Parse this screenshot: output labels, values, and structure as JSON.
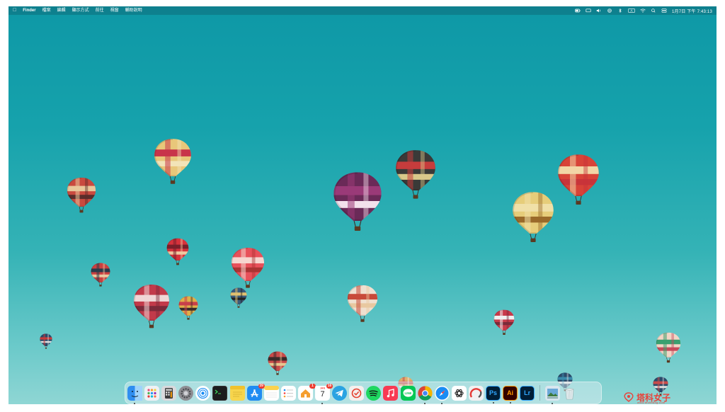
{
  "menubar": {
    "apple_icon": "apple-icon",
    "app_name": "Finder",
    "items": [
      "檔案",
      "編輯",
      "顯示方式",
      "前往",
      "視窗",
      "輔助說明"
    ],
    "status_icons": [
      "battery-icon",
      "display-icon",
      "volume-icon",
      "airdrop-icon",
      "bluetooth-icon",
      "input-source-icon",
      "wifi-icon",
      "search-icon",
      "control-center-icon"
    ],
    "input_source_label": "A",
    "clock": "1月7日 下午 7:43:13"
  },
  "dock": {
    "apps": [
      {
        "name": "Finder",
        "icon": "finder-icon",
        "color": "#2f8ef0",
        "running": true
      },
      {
        "name": "Launchpad",
        "icon": "launchpad-icon",
        "color": "#eef1f5",
        "running": false
      },
      {
        "name": "Calculator",
        "icon": "calculator-icon",
        "color": "#3a3a3c",
        "running": false
      },
      {
        "name": "System Settings",
        "icon": "gear-icon",
        "color": "#8e8e93",
        "running": false
      },
      {
        "name": "AirDrop",
        "icon": "airdrop-icon",
        "color": "#ffffff",
        "running": false
      },
      {
        "name": "Terminal",
        "icon": "terminal-icon",
        "color": "#1c1c1e",
        "running": false
      },
      {
        "name": "Stickies",
        "icon": "stickies-icon",
        "color": "#f7d54c",
        "running": false
      },
      {
        "name": "App Store",
        "icon": "app-store-icon",
        "color": "#1f8cf2",
        "running": false,
        "badge": "39"
      },
      {
        "name": "Notes",
        "icon": "notes-icon",
        "color": "#fbe27a",
        "running": false
      },
      {
        "name": "Reminders",
        "icon": "reminders-icon",
        "color": "#ffffff",
        "running": false
      },
      {
        "name": "Home",
        "icon": "home-icon",
        "color": "#ffffff",
        "running": false,
        "badge": "1"
      },
      {
        "name": "Calendar",
        "icon": "calendar-icon",
        "color": "#ffffff",
        "running": true,
        "badge": "16",
        "day": "7"
      },
      {
        "name": "Telegram",
        "icon": "telegram-icon",
        "color": "#2aa3e2",
        "running": false
      },
      {
        "name": "Todoist",
        "icon": "todoist-icon",
        "color": "#f4f0ee",
        "running": false
      },
      {
        "name": "Spotify",
        "icon": "spotify-icon",
        "color": "#1ed760",
        "running": false
      },
      {
        "name": "Music",
        "icon": "music-icon",
        "color": "#f83a53",
        "running": false
      },
      {
        "name": "LINE",
        "icon": "line-icon",
        "color": "#06c755",
        "running": false
      },
      {
        "name": "Chrome",
        "icon": "chrome-icon",
        "color": "#ffffff",
        "running": true
      },
      {
        "name": "Safari",
        "icon": "safari-icon",
        "color": "#1a8cf4",
        "running": true
      },
      {
        "name": "ChatGPT",
        "icon": "chatgpt-icon",
        "color": "#ffffff",
        "running": false
      },
      {
        "name": "Screen Recorder",
        "icon": "recorder-icon",
        "color": "#f1f1f1",
        "running": false
      },
      {
        "name": "Photoshop",
        "icon": "photoshop-icon",
        "color": "#001e36",
        "running": true,
        "label": "Ps",
        "label_color": "#31a8ff"
      },
      {
        "name": "Illustrator",
        "icon": "illustrator-icon",
        "color": "#330000",
        "running": true,
        "label": "Ai",
        "label_color": "#ff9a00"
      },
      {
        "name": "Lightroom",
        "icon": "lightroom-icon",
        "color": "#001e36",
        "running": false,
        "label": "Lr",
        "label_color": "#31a8ff"
      }
    ],
    "extras": [
      {
        "name": "Preview",
        "icon": "preview-icon",
        "running": true
      },
      {
        "name": "Trash",
        "icon": "trash-icon",
        "running": false
      }
    ]
  },
  "watermark": {
    "text": "塔科女子",
    "url": "www.techbang.com"
  }
}
